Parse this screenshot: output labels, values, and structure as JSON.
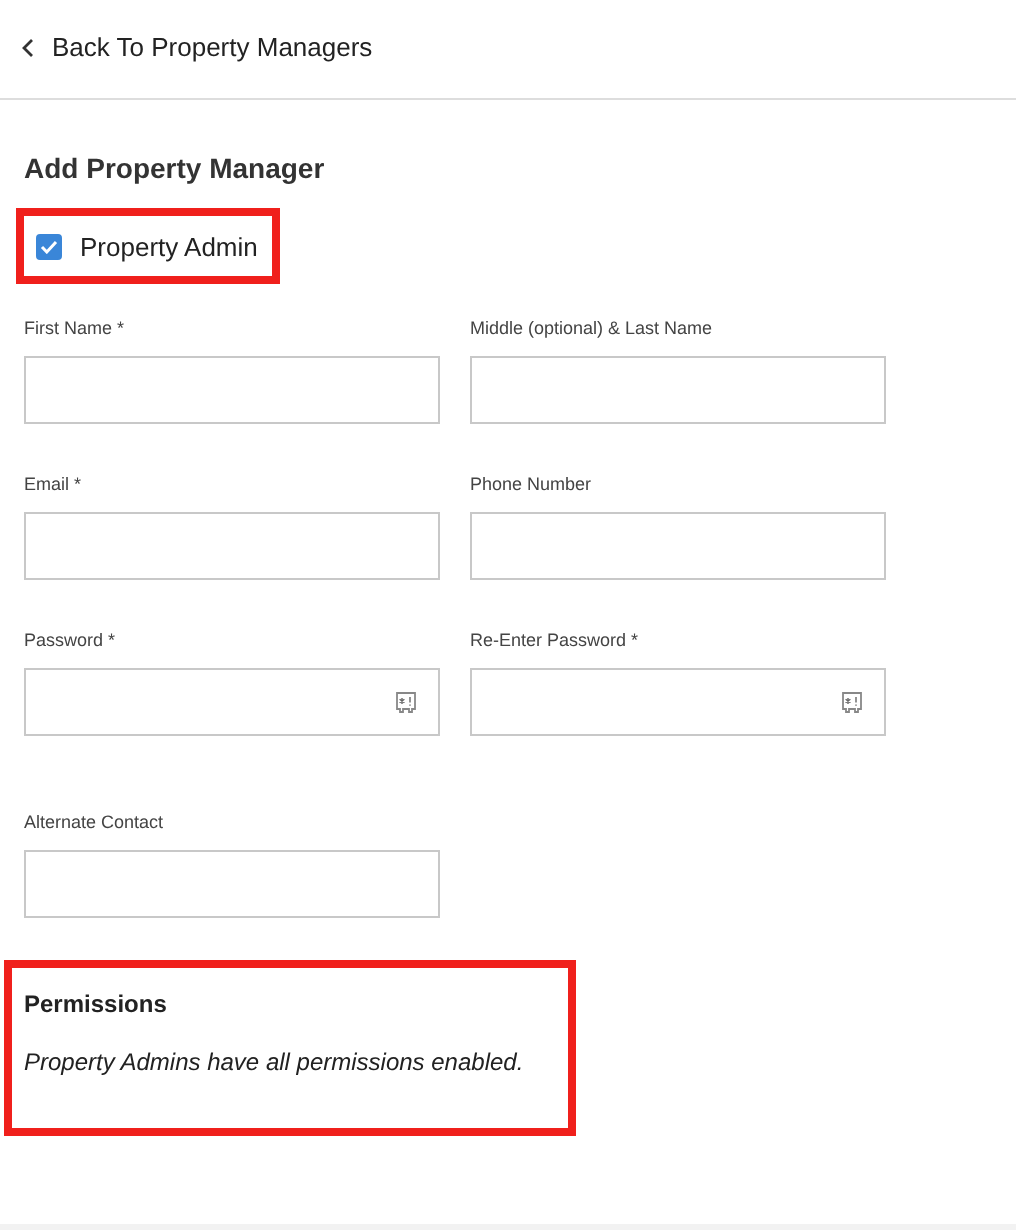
{
  "back_link": {
    "label": "Back To Property Managers"
  },
  "form": {
    "title": "Add Property Manager",
    "admin_checkbox": {
      "label": "Property Admin",
      "checked": true,
      "highlighted": true
    },
    "fields": [
      {
        "label": "First Name *",
        "kind": "text"
      },
      {
        "label": "Middle (optional) & Last Name",
        "kind": "text"
      },
      {
        "label": "Email *",
        "kind": "text"
      },
      {
        "label": "Phone Number",
        "kind": "text"
      },
      {
        "label": "Password *",
        "kind": "password"
      },
      {
        "label": "Re-Enter Password *",
        "kind": "password"
      },
      {
        "label": "Alternate Contact",
        "kind": "text"
      }
    ]
  },
  "permissions": {
    "title": "Permissions",
    "note": "Property Admins have all permissions enabled.",
    "highlighted": true
  }
}
